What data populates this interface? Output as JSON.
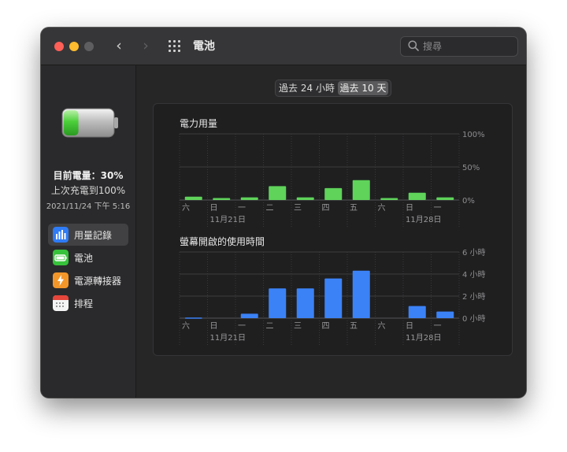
{
  "window": {
    "title": "電池",
    "search_placeholder": "搜尋"
  },
  "sidebar": {
    "battery_level_text": "目前電量：30%",
    "last_charged_text": "上次充電到100%",
    "last_charged_time": "2021/11/24 下午 5:16",
    "battery_level": 0.3,
    "items": [
      {
        "label": "用量記錄",
        "icon": "usage-history-icon",
        "color": "#2f7cf6",
        "active": true
      },
      {
        "label": "電池",
        "icon": "battery-icon",
        "color": "#37c23b",
        "active": false
      },
      {
        "label": "電源轉接器",
        "icon": "power-adapter-icon",
        "color": "#f2962a",
        "active": false
      },
      {
        "label": "排程",
        "icon": "schedule-icon",
        "color": "#f5f5f5",
        "active": false
      }
    ]
  },
  "segmented": {
    "options": [
      "過去 24 小時",
      "過去 10 天"
    ],
    "selected": 1
  },
  "chart_data": [
    {
      "type": "bar",
      "title": "電力用量",
      "categories": [
        "六",
        "日",
        "一",
        "二",
        "三",
        "四",
        "五",
        "六",
        "日",
        "一"
      ],
      "date_labels": [
        "",
        "11月21日",
        "",
        "",
        "",
        "",
        "",
        "",
        "11月28日",
        ""
      ],
      "values": [
        5,
        3,
        4,
        21,
        4,
        18,
        30,
        3,
        11,
        4
      ],
      "ylim": [
        0,
        100
      ],
      "y_ticks": [
        "100%",
        "50%",
        "0%"
      ],
      "color": "#5fd35a"
    },
    {
      "type": "bar",
      "title": "螢幕開啟的使用時間",
      "categories": [
        "六",
        "日",
        "一",
        "二",
        "三",
        "四",
        "五",
        "六",
        "日",
        "一"
      ],
      "date_labels": [
        "",
        "11月21日",
        "",
        "",
        "",
        "",
        "",
        "",
        "11月28日",
        ""
      ],
      "values": [
        0.05,
        0,
        0.4,
        2.7,
        2.7,
        3.6,
        4.3,
        0,
        1.1,
        0.6
      ],
      "ylim": [
        0,
        6
      ],
      "y_ticks": [
        "6 小時",
        "4 小時",
        "2 小時",
        "0 小時"
      ],
      "color": "#3b82f6"
    }
  ],
  "help_label": "?"
}
